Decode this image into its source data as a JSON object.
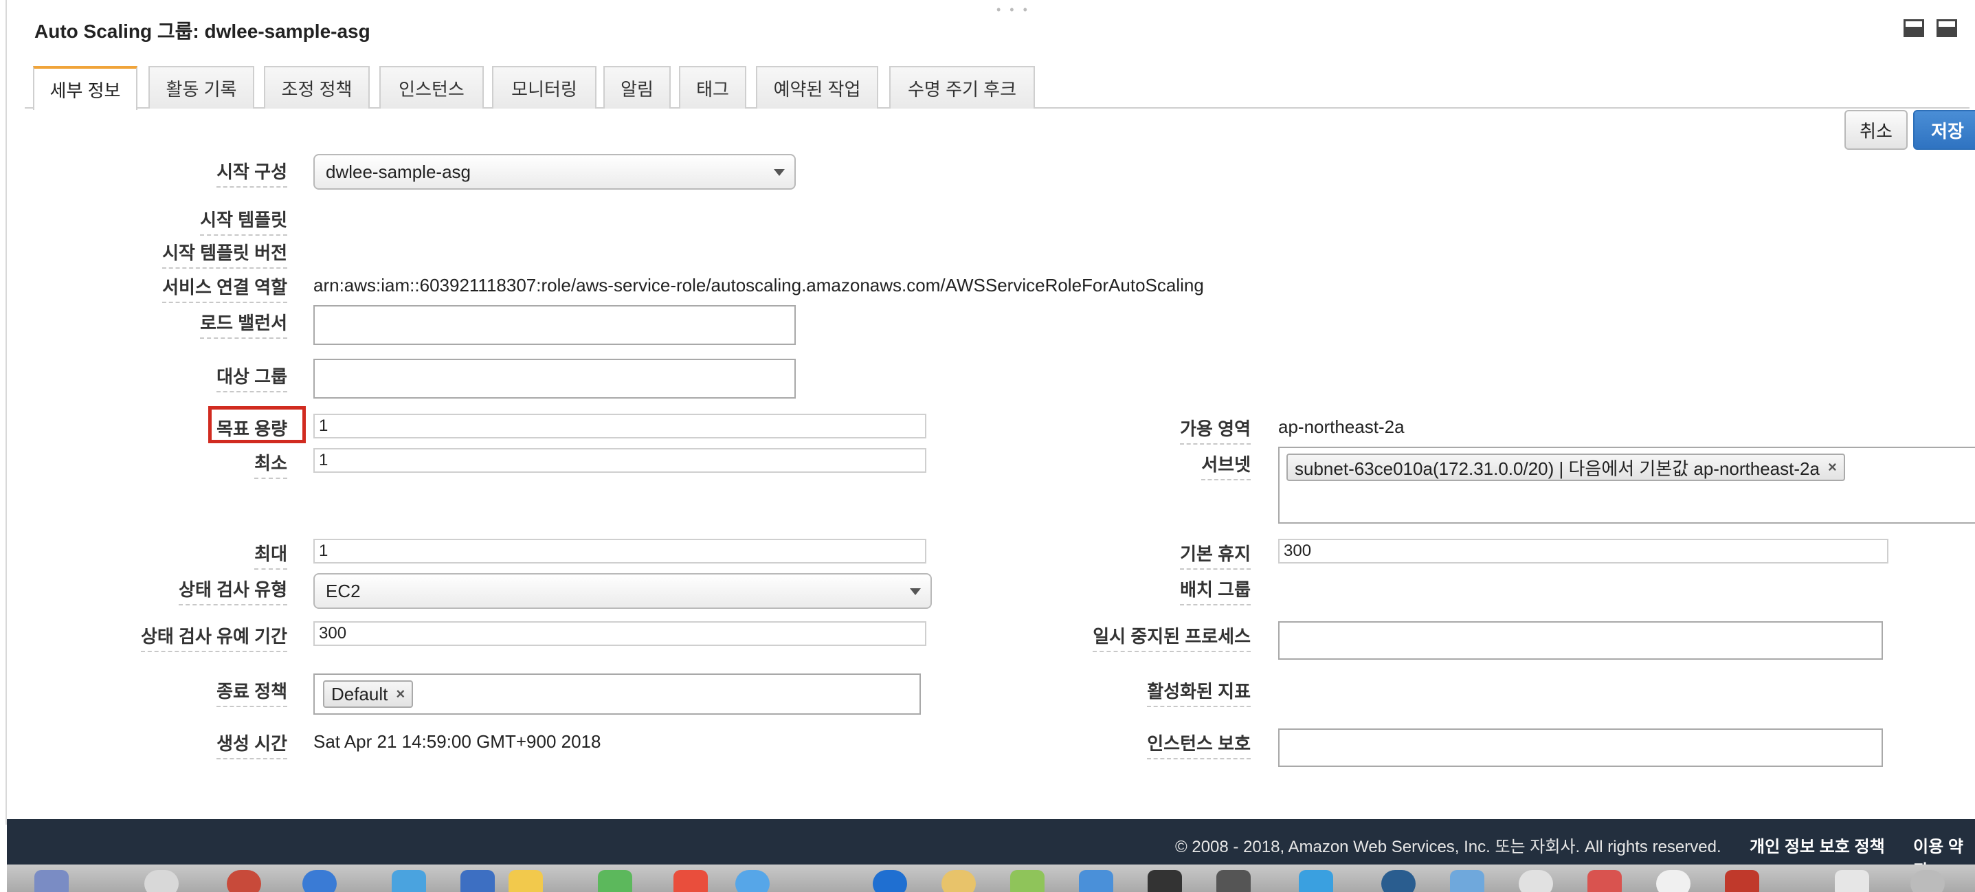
{
  "panel": {
    "title": "Auto Scaling 그룹: dwlee-sample-asg",
    "grip": "• • •"
  },
  "tabs": [
    {
      "label": "세부 정보",
      "active": true
    },
    {
      "label": "활동 기록"
    },
    {
      "label": "조정 정책"
    },
    {
      "label": "인스턴스"
    },
    {
      "label": "모니터링"
    },
    {
      "label": "알림"
    },
    {
      "label": "태그"
    },
    {
      "label": "예약된 작업"
    },
    {
      "label": "수명 주기 후크"
    }
  ],
  "actions": {
    "cancel": "취소",
    "save": "저장"
  },
  "form": {
    "launch_config": {
      "label": "시작 구성",
      "value": "dwlee-sample-asg"
    },
    "launch_template": {
      "label": "시작 템플릿"
    },
    "launch_template_version": {
      "label": "시작 템플릿 버전"
    },
    "service_role": {
      "label": "서비스 연결 역할",
      "value": "arn:aws:iam::603921118307:role/aws-service-role/autoscaling.amazonaws.com/AWSServiceRoleForAutoScaling"
    },
    "load_balancer": {
      "label": "로드 밸런서",
      "value": ""
    },
    "target_group": {
      "label": "대상 그룹",
      "value": ""
    },
    "desired_capacity": {
      "label": "목표 용량",
      "value": "1"
    },
    "min": {
      "label": "최소",
      "value": "1"
    },
    "max": {
      "label": "최대",
      "value": "1"
    },
    "health_check_type": {
      "label": "상태 검사 유형",
      "value": "EC2"
    },
    "health_check_grace": {
      "label": "상태 검사 유예 기간",
      "value": "300"
    },
    "termination_policy": {
      "label": "종료 정책",
      "chip": "Default",
      "remove": "×"
    },
    "created_time": {
      "label": "생성 시간",
      "value": "Sat Apr 21 14:59:00 GMT+900 2018"
    },
    "availability_zone": {
      "label": "가용 영역",
      "value": "ap-northeast-2a"
    },
    "subnet": {
      "label": "서브넷",
      "chip": "subnet-63ce010a(172.31.0.0/20) | 다음에서 기본값 ap-northeast-2a",
      "remove": "×"
    },
    "default_cooldown": {
      "label": "기본 휴지",
      "value": "300"
    },
    "placement_group": {
      "label": "배치 그룹"
    },
    "suspended_processes": {
      "label": "일시 중지된 프로세스",
      "value": ""
    },
    "enabled_metrics": {
      "label": "활성화된 지표"
    },
    "instance_protection": {
      "label": "인스턴스 보호",
      "value": ""
    }
  },
  "footer": {
    "copyright": "© 2008 - 2018, Amazon Web Services, Inc. 또는 자회사. All rights reserved.",
    "privacy": "개인 정보 보호 정책",
    "terms": "이용 약관"
  },
  "colors": {
    "highlight": "#d12b20",
    "save_button": "#2f73c1",
    "active_tab_accent": "#f0a43a",
    "footer_bg": "#232f3e"
  }
}
